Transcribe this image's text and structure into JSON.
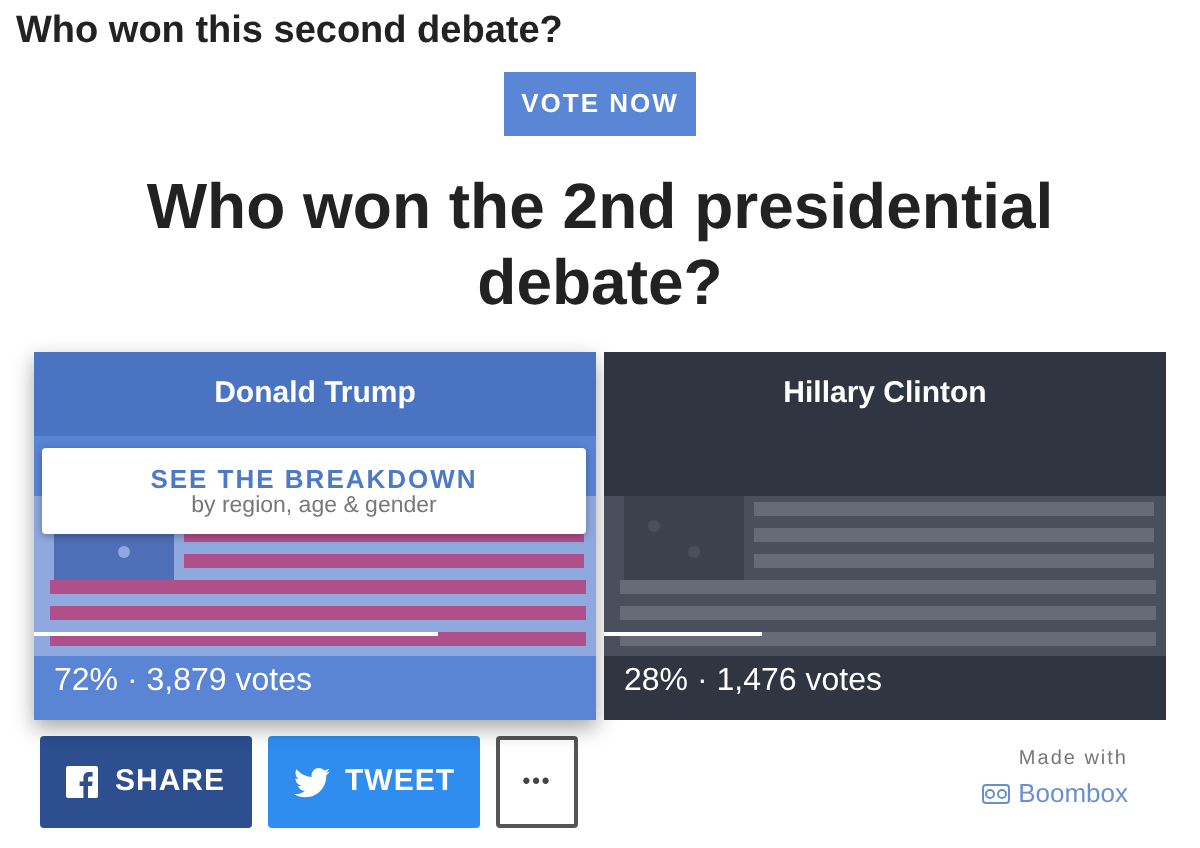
{
  "page_heading": "Who won this second debate?",
  "badge": "VOTE NOW",
  "title": "Who won the 2nd presidential debate?",
  "options": [
    {
      "name": "Donald Trump",
      "selected": true,
      "level": 0.72,
      "result": "72% · 3,879 votes"
    },
    {
      "name": "Hillary Clinton",
      "selected": false,
      "level": 0.28,
      "result": "28% · 1,476 votes"
    }
  ],
  "breakdown": {
    "title": "SEE THE BREAKDOWN",
    "subtitle": "by region, age & gender"
  },
  "share_buttons": [
    {
      "kind": "facebook",
      "label": "SHARE"
    },
    {
      "kind": "twitter",
      "label": "TWEET"
    },
    {
      "kind": "more",
      "label": "•••"
    }
  ],
  "credit": {
    "caption": "Made with",
    "brand": "Boombox"
  }
}
